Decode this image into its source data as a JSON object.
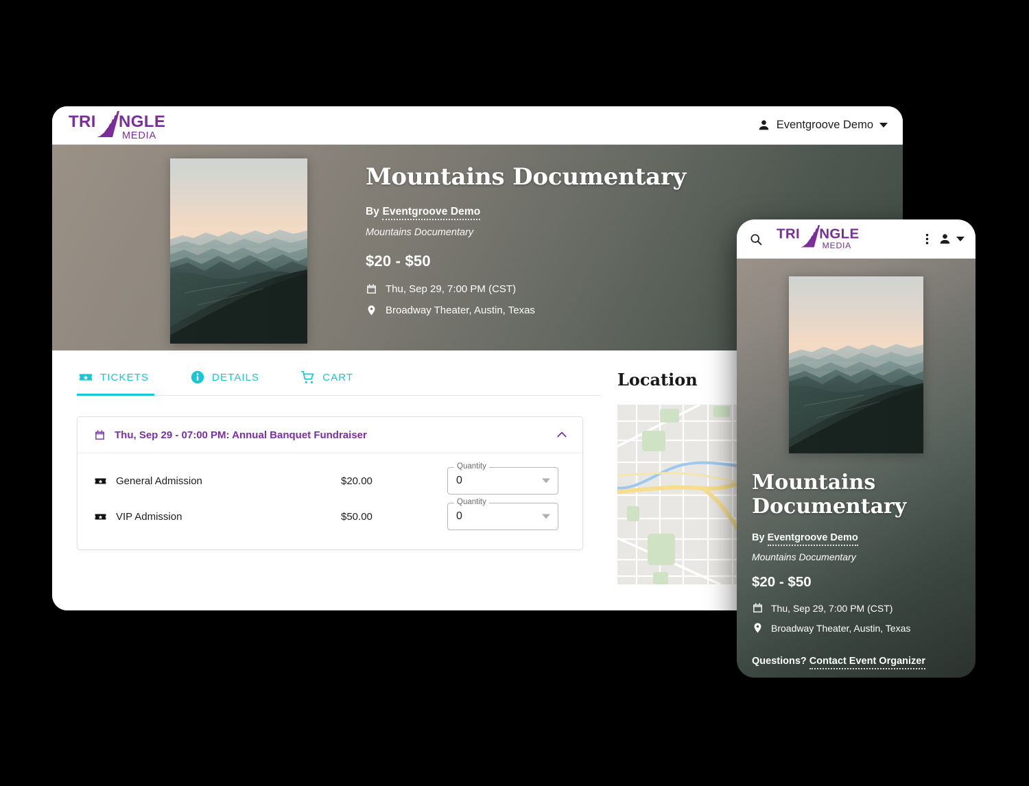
{
  "brand": {
    "logo_text_left": "TRI",
    "logo_text_right": "NGLE",
    "logo_subtext": "MEDIA",
    "purple": "#7b2d9a",
    "accent_cyan": "#17c7d6",
    "accent_purple": "#7a2ea8"
  },
  "desktop": {
    "header": {
      "account_name": "Eventgroove Demo",
      "account_icon": "person-icon",
      "caret_icon": "chevron-down-icon"
    },
    "hero": {
      "poster_alt": "Mountains Documentary poster",
      "title": "Mountains Documentary",
      "by_prefix": "By",
      "by_organizer": "Eventgroove Demo",
      "subtitle": "Mountains Documentary",
      "price_range": "$20 - $50",
      "date_icon": "calendar-icon",
      "date": "Thu, Sep 29, 7:00 PM (CST)",
      "location_icon": "map-pin-icon",
      "location": "Broadway Theater, Austin, Texas"
    },
    "tabs": [
      {
        "label": "TICKETS",
        "icon": "ticket-icon",
        "active": true
      },
      {
        "label": "DETAILS",
        "icon": "info-icon",
        "active": false
      },
      {
        "label": "CART",
        "icon": "cart-icon",
        "active": false
      }
    ],
    "accordion": {
      "icon": "calendar-icon",
      "header": "Thu, Sep 29 - 07:00 PM: Annual Banquet Fundraiser",
      "toggle_icon": "chevron-up-icon",
      "expanded": true,
      "rows": [
        {
          "icon": "ticket-icon",
          "name": "General Admission",
          "price": "$20.00",
          "qty_label": "Quantity",
          "qty_value": "0"
        },
        {
          "icon": "ticket-icon",
          "name": "VIP Admission",
          "price": "$50.00",
          "qty_label": "Quantity",
          "qty_value": "0"
        }
      ]
    },
    "location_panel": {
      "title": "Location",
      "map_alt": "street map of Austin, Texas"
    }
  },
  "mobile": {
    "header": {
      "search_icon": "search-icon",
      "menu_icon": "more-vert-icon",
      "account_icon": "person-icon",
      "caret_icon": "chevron-down-icon"
    },
    "hero": {
      "poster_alt": "Mountains Documentary poster",
      "title": "Mountains Documentary",
      "by_prefix": "By",
      "by_organizer": "Eventgroove Demo",
      "subtitle": "Mountains Documentary",
      "price_range": "$20 - $50",
      "date_icon": "calendar-icon",
      "date": "Thu, Sep 29, 7:00 PM (CST)",
      "location_icon": "map-pin-icon",
      "location": "Broadway Theater, Austin, Texas",
      "questions_prefix": "Questions?",
      "contact_link": "Contact Event Organizer"
    }
  }
}
